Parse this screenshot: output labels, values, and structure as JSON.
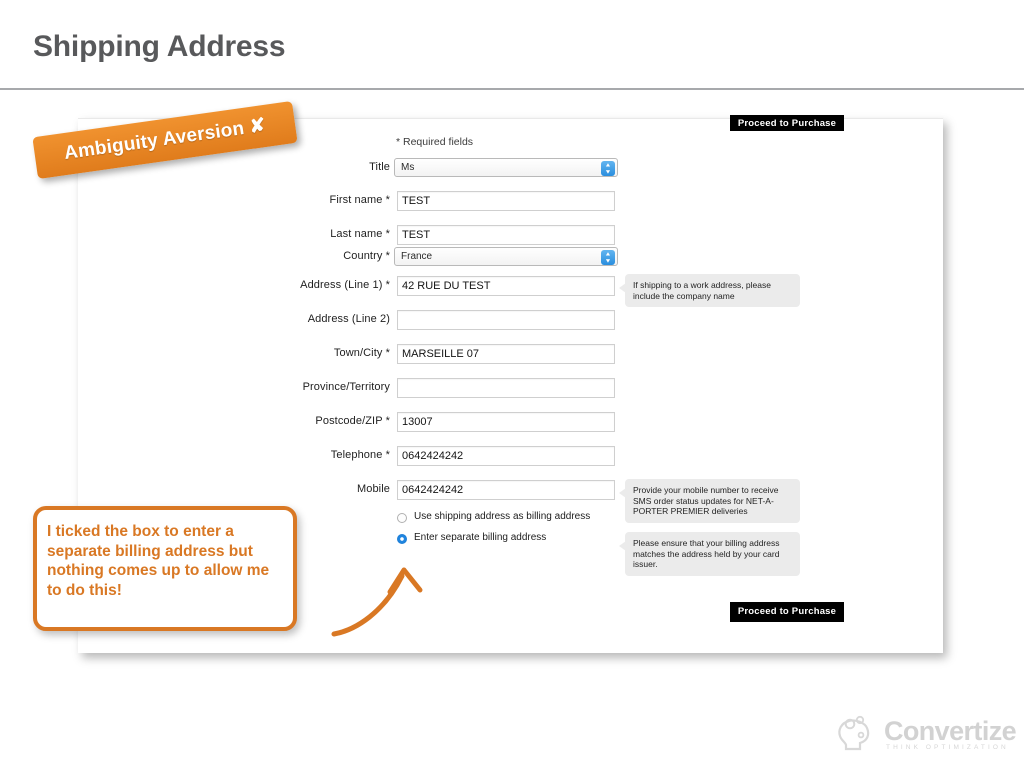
{
  "slide": {
    "title": "Shipping Address"
  },
  "banner": {
    "label": "Ambiguity Aversion ✘"
  },
  "note": {
    "text": "I ticked the box to enter a separate billing address but nothing comes up to allow me to do this!",
    "accent_color": "#d97824"
  },
  "form": {
    "required_note": "* Required fields",
    "fields": [
      {
        "label": "Title",
        "value": "Ms",
        "type": "select"
      },
      {
        "label": "First name *",
        "value": "TEST",
        "type": "text"
      },
      {
        "label": "Last name *",
        "value": "TEST",
        "type": "text"
      },
      {
        "label": "Country *",
        "value": "France",
        "type": "select"
      },
      {
        "label": "Address (Line 1) *",
        "value": "42 RUE DU TEST",
        "type": "text"
      },
      {
        "label": "Address (Line 2)",
        "value": "",
        "type": "text"
      },
      {
        "label": "Town/City *",
        "value": "MARSEILLE 07",
        "type": "text"
      },
      {
        "label": "Province/Territory",
        "value": "",
        "type": "text"
      },
      {
        "label": "Postcode/ZIP *",
        "value": "13007",
        "type": "text"
      },
      {
        "label": "Telephone *",
        "value": "0642424242",
        "type": "text"
      },
      {
        "label": "Mobile",
        "value": "0642424242",
        "type": "text"
      }
    ],
    "radios": [
      {
        "label": "Use shipping address as billing address",
        "checked": false
      },
      {
        "label": "Enter separate billing address",
        "checked": true
      }
    ],
    "tooltips": [
      {
        "text": "If shipping to a work address, please include the company name"
      },
      {
        "text": "Provide your mobile number to receive SMS order status updates for NET-A-PORTER PREMIER deliveries"
      },
      {
        "text": "Please ensure that your billing address matches the address held by your card issuer."
      }
    ],
    "buttons": {
      "proceed_top": "Proceed to Purchase",
      "proceed_bottom": "Proceed to Purchase"
    }
  },
  "logo": {
    "wordmark": "Convertize",
    "tagline": "THINK OPTIMIZATION"
  }
}
